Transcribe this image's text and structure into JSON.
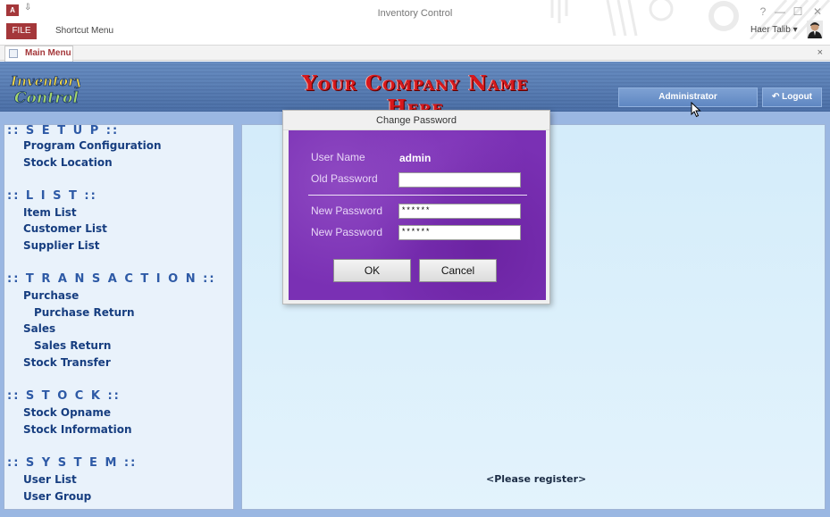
{
  "window": {
    "title": "Inventory Control",
    "file_tab": "FILE",
    "shortcut_menu": "Shortcut Menu",
    "user": "Haer Talib",
    "help": "?",
    "minimize": "—",
    "maximize": "☐",
    "close": "✕",
    "qat_glyph": "⇩"
  },
  "tab": {
    "label": "Main Menu",
    "close": "×"
  },
  "header": {
    "logo_line1": "Inventory",
    "logo_line2": "Control",
    "company_name": "Your Company Name Here",
    "admin_label": "Administrator",
    "logout_label": "Logout",
    "logout_icon": "↶"
  },
  "sidebar": {
    "sections": [
      {
        "header": ":: S E T U P ::",
        "items": [
          "Program Configuration",
          "Stock Location"
        ]
      },
      {
        "header": ":: L I S T ::",
        "items": [
          "Item List",
          "Customer List",
          "Supplier List"
        ]
      },
      {
        "header": ":: T R A N S A C T I O N ::",
        "items": [
          "Purchase",
          "Purchase Return",
          "Sales",
          "Sales Return",
          "Stock Transfer"
        ]
      },
      {
        "header": ":: S T O C K ::",
        "items": [
          "Stock Opname",
          "Stock Information"
        ]
      },
      {
        "header": ":: S Y S T E M ::",
        "items": [
          "User List",
          "User Group"
        ]
      }
    ]
  },
  "main": {
    "register_note": "<Please register>"
  },
  "dialog": {
    "title": "Change Password",
    "user_name_label": "User Name",
    "user_name_value": "admin",
    "old_password_label": "Old Password",
    "old_password_value": "",
    "new_password_label": "New Password",
    "new_password_value": "******",
    "confirm_password_label": "New Password",
    "confirm_password_value": "******",
    "ok_label": "OK",
    "cancel_label": "Cancel"
  },
  "colors": {
    "accent": "#a4373a",
    "header_blue": "#5179b3",
    "dialog_purple": "#7a30b4",
    "company_red": "#d7181c",
    "menu_text": "#173e80"
  }
}
